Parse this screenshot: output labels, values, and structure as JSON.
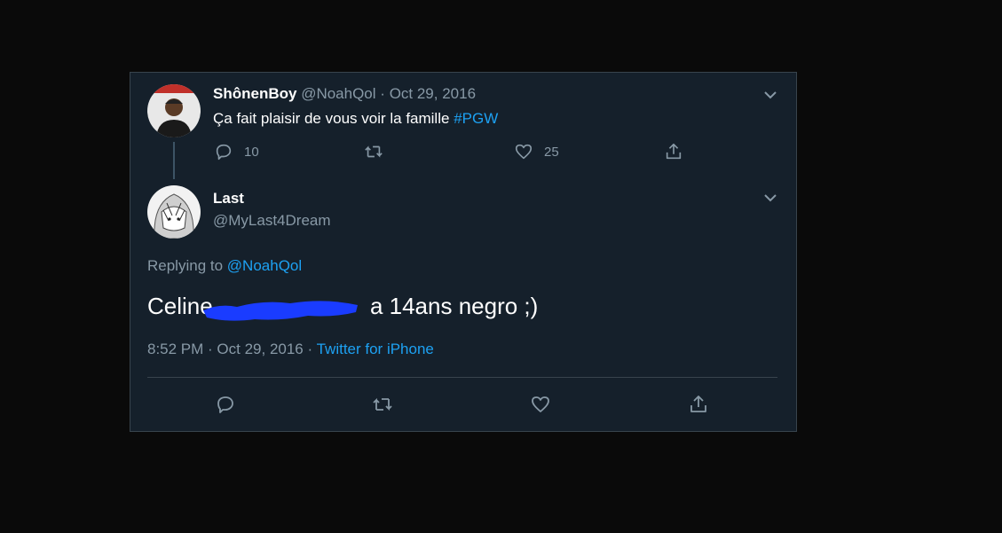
{
  "tweet1": {
    "display_name": "ShônenBoy",
    "handle": "@NoahQol",
    "date": "Oct 29, 2016",
    "text": "Ça fait plaisir de vous voir la famille",
    "hashtag": "#PGW",
    "reply_count": "10",
    "like_count": "25"
  },
  "tweet2": {
    "display_name": "Last",
    "handle": "@MyLast4Dream",
    "replying_prefix": "Replying to",
    "replying_to": "@NoahQol",
    "text_before": "Celine",
    "text_after": " a 14ans negro ;)",
    "timestamp": "8:52 PM · Oct 29, 2016",
    "source": "Twitter for iPhone"
  },
  "colors": {
    "background": "#0a0a0a",
    "card": "#15202b",
    "border": "#38444d",
    "muted": "#8899a6",
    "link": "#1da1f2",
    "redaction": "#1a3cff"
  },
  "icons": [
    "reply-icon",
    "retweet-icon",
    "like-icon",
    "share-icon",
    "chevron-down-icon"
  ]
}
